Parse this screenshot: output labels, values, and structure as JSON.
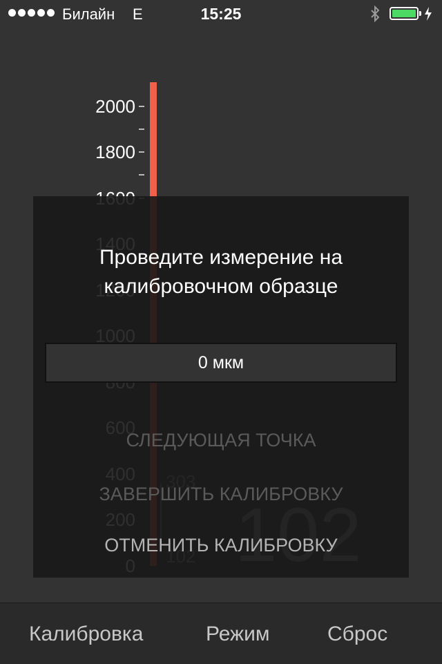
{
  "status_bar": {
    "carrier": "Билайн",
    "network": "E",
    "time": "15:25"
  },
  "gauge": {
    "tick_labels": [
      "2000",
      "1800",
      "1600",
      "1400",
      "1200",
      "1000",
      "800",
      "600",
      "400",
      "200",
      "0"
    ],
    "bar_color": "#f0604a",
    "bg_small_value": "303",
    "bg_small_value2": "102",
    "bg_big_value": "102"
  },
  "modal": {
    "title_line1": "Проведите измерение на",
    "title_line2": "калибровочном образце",
    "value": "0 мкм",
    "next_point": "СЛЕДУЮЩАЯ ТОЧКА",
    "finish_calibration": "ЗАВЕРШИТЬ КАЛИБРОВКУ",
    "cancel_calibration": "ОТМЕНИТЬ КАЛИБРОВКУ"
  },
  "toolbar": {
    "calibration": "Калибровка",
    "mode": "Режим",
    "reset": "Сброс"
  }
}
